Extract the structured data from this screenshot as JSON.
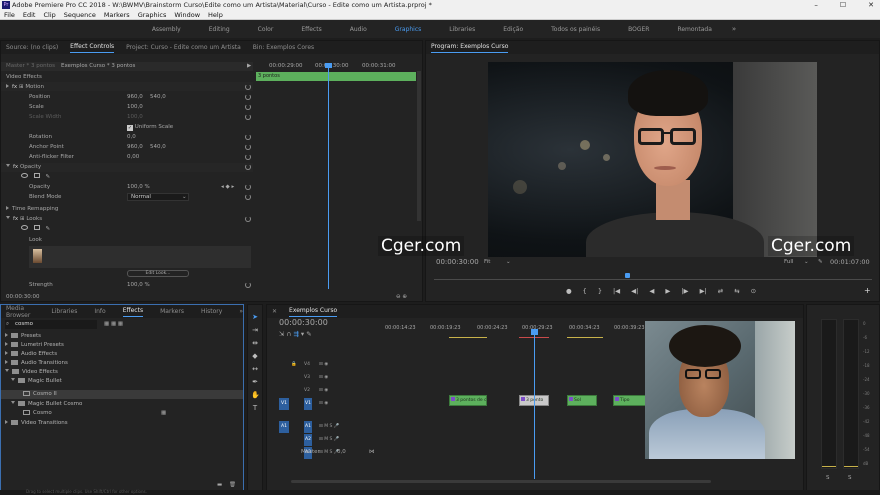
{
  "title_bar": {
    "app_icon_text": "Pr",
    "title": "Adobe Premiere Pro CC 2018 - W:\\BWMV\\Brainstorm Curso\\Edite como um Artista\\Material\\Curso - Edite como um Artista.prproj *",
    "min": "–",
    "max": "☐",
    "close": "✕"
  },
  "menu": [
    "File",
    "Edit",
    "Clip",
    "Sequence",
    "Markers",
    "Graphics",
    "Window",
    "Help"
  ],
  "workspaces": {
    "items": [
      "Assembly",
      "Editing",
      "Color",
      "Effects",
      "Audio",
      "Graphics",
      "Libraries",
      "Edição",
      "Todos os painéis",
      "BOGER",
      "Remontada"
    ],
    "active_index": 5,
    "more": "»"
  },
  "effect_controls": {
    "tabs": [
      "Source: (no clips)",
      "Effect Controls",
      "Project: Curso - Edite como um Artista",
      "Bin: Exemplos Cores"
    ],
    "active_tab": 1,
    "master_label": "Master * 3 pontos",
    "clip_label": "Exemplos Curso * 3 pontos",
    "ruler": [
      "00:00:29:00",
      "00:00:30:00",
      "00:00:31:00"
    ],
    "clip_bar_label": "3 pontos",
    "section_video_effects": "Video Effects",
    "motion": "Motion",
    "position_label": "Position",
    "position_x": "960,0",
    "position_y": "540,0",
    "scale_label": "Scale",
    "scale_value": "100,0",
    "scale_width_label": "Scale Width",
    "scale_width_value": "100,0",
    "uniform_scale": "Uniform Scale",
    "rotation_label": "Rotation",
    "rotation_value": "0,0",
    "anchor_label": "Anchor Point",
    "anchor_x": "960,0",
    "anchor_y": "540,0",
    "antiflicker_label": "Anti-flicker Filter",
    "antiflicker_value": "0,00",
    "opacity_section": "Opacity",
    "opacity_label": "Opacity",
    "opacity_value": "100,0 %",
    "blend_label": "Blend Mode",
    "blend_value": "Normal",
    "time_remap": "Time Remapping",
    "looks": "Looks",
    "look_label": "Look",
    "edit_look": "Edit Look...",
    "strength_label": "Strength",
    "strength_value": "100,0 %",
    "timecode": "00:00:30:00"
  },
  "program_monitor": {
    "title": "Program: Exemplos Curso",
    "timecode": "00:00:30:00",
    "fit": "Fit",
    "quality": "Full",
    "duration": "00:01:07:00",
    "transport": [
      "●",
      "{",
      "}",
      "|◀",
      "◀|",
      "◀",
      "▶",
      "|▶",
      "▶|",
      "⇄",
      "⇆",
      "⊙"
    ],
    "plus": "+"
  },
  "effects_panel": {
    "tabs": [
      "Media Browser",
      "Libraries",
      "Info",
      "Effects",
      "Markers",
      "History"
    ],
    "active_tab": 3,
    "more": "»",
    "search_value": "cosmo",
    "tree": [
      {
        "label": "Presets",
        "depth": 0,
        "open": false
      },
      {
        "label": "Lumetri Presets",
        "depth": 0,
        "open": false
      },
      {
        "label": "Audio Effects",
        "depth": 0,
        "open": false
      },
      {
        "label": "Audio Transitions",
        "depth": 0,
        "open": false
      },
      {
        "label": "Video Effects",
        "depth": 0,
        "open": true
      },
      {
        "label": "Magic Bullet",
        "depth": 1,
        "open": true
      },
      {
        "label": "Cosmo II",
        "depth": 2,
        "open": false,
        "selected": true
      },
      {
        "label": "Magic Bullet Cosmo",
        "depth": 1,
        "open": true
      },
      {
        "label": "Cosmo",
        "depth": 2,
        "open": false
      },
      {
        "label": "Video Transitions",
        "depth": 0,
        "open": false
      }
    ]
  },
  "timeline": {
    "sequence_tab": "Exemplos Curso",
    "timecode": "00:00:30:00",
    "ruler": [
      "00:00:14:23",
      "00:00:19:23",
      "00:00:24:23",
      "00:00:29:23",
      "00:00:34:23",
      "00:00:39:23"
    ],
    "video_tracks": [
      "V4",
      "V3",
      "V2",
      "V1"
    ],
    "audio_tracks": [
      "A1",
      "A2",
      "A3"
    ],
    "source_v": "V1",
    "source_a": "A1",
    "master_label": "Master",
    "master_value": "0,0",
    "clips": [
      {
        "label": "3 pontos de c"
      },
      {
        "label": "3 ponto"
      },
      {
        "label": "Sol"
      },
      {
        "label": "Tipo"
      }
    ],
    "meter_labels": [
      "S",
      "S"
    ],
    "db_marks": [
      "0",
      "-6",
      "-12",
      "-18",
      "-24",
      "-30",
      "-36",
      "-42",
      "-48",
      "-54",
      "dB"
    ]
  },
  "watermarks": [
    "Cger.com",
    "Cger.com"
  ],
  "status_bar": "Drag to select multiple clips. Use Shift/Ctrl for other options."
}
